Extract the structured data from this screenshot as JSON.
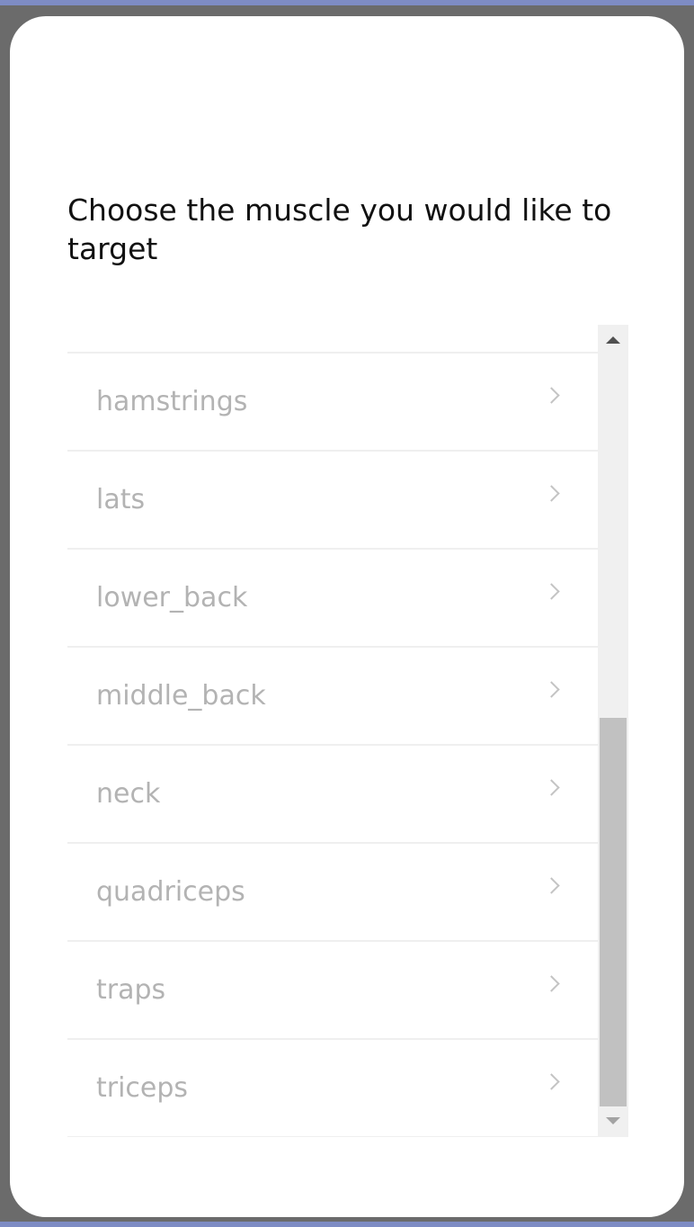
{
  "prompt": "Choose the muscle you would like to target",
  "muscles": [
    {
      "label": "hamstrings"
    },
    {
      "label": "lats"
    },
    {
      "label": "lower_back"
    },
    {
      "label": "middle_back"
    },
    {
      "label": "neck"
    },
    {
      "label": "quadriceps"
    },
    {
      "label": "traps"
    },
    {
      "label": "triceps"
    }
  ],
  "icons": {
    "item_chevron": "chevron-right-icon",
    "scroll_up": "scroll-up-arrow-icon",
    "scroll_down": "scroll-down-arrow-icon"
  },
  "colors": {
    "frame": "#6b6b6b",
    "accent": "#7e8cc4",
    "card": "#ffffff",
    "item_text": "#b3b3b3",
    "divider": "#efefef"
  },
  "scroll": {
    "position": "bottom"
  }
}
